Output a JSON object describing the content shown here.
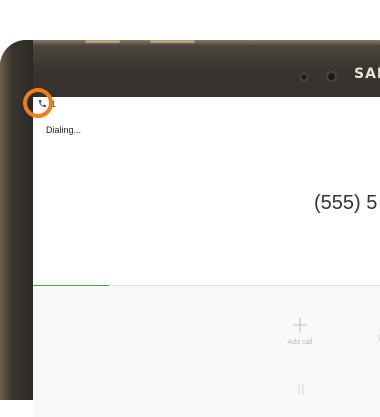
{
  "device": {
    "brand_text": "SAM"
  },
  "status_bar": {
    "phone_icon": "phone-icon",
    "cut_text": "1"
  },
  "call": {
    "state": "Dialing...",
    "number": "(555) 5",
    "progress_fraction": 0.21
  },
  "controls": {
    "add_call": {
      "icon": "plus-icon",
      "glyph": "+",
      "label": "Add call"
    },
    "volume": {
      "label": "V"
    },
    "hold": {
      "icon": "pause-icon",
      "glyph": "II"
    }
  },
  "highlight": {
    "color": "#ef7d1a"
  },
  "colors": {
    "progress": "#46a05a"
  }
}
